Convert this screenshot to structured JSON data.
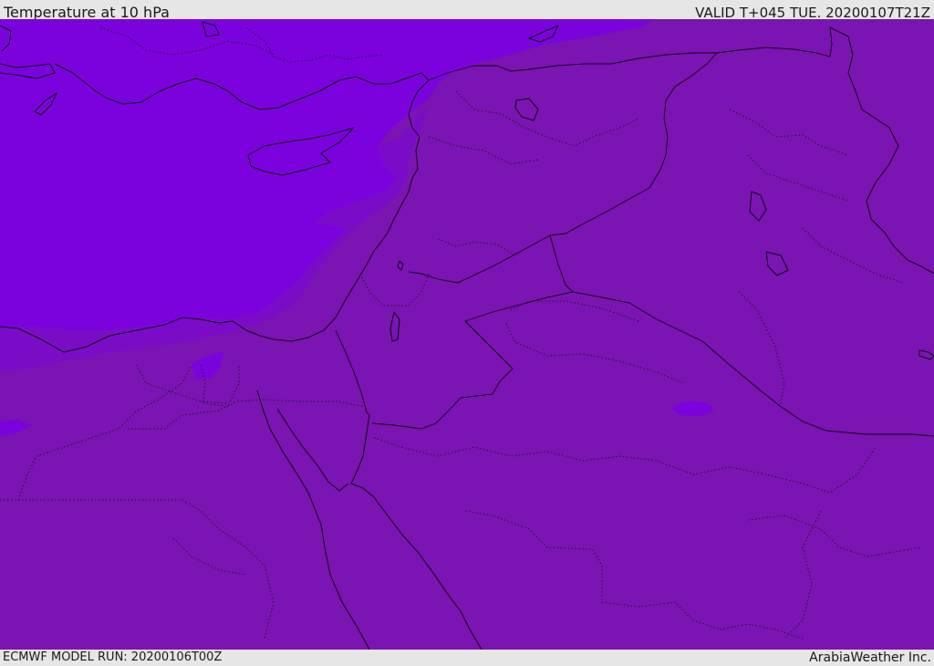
{
  "header": {
    "title": "Temperature at 10 hPa",
    "valid": "VALID T+045 TUE. 20200107T21Z"
  },
  "footer": {
    "model_run": "ECMWF MODEL RUN: 20200106T00Z",
    "credit": "ArabiaWeather Inc."
  },
  "map": {
    "field": "temperature",
    "level": "10 hPa",
    "fill_colors": {
      "main": "#7a14b2",
      "cold_region": "#7b02dd",
      "intermediate": "#7a0cc8"
    },
    "lines": [
      "coastline",
      "national-borders",
      "admin-borders"
    ]
  }
}
